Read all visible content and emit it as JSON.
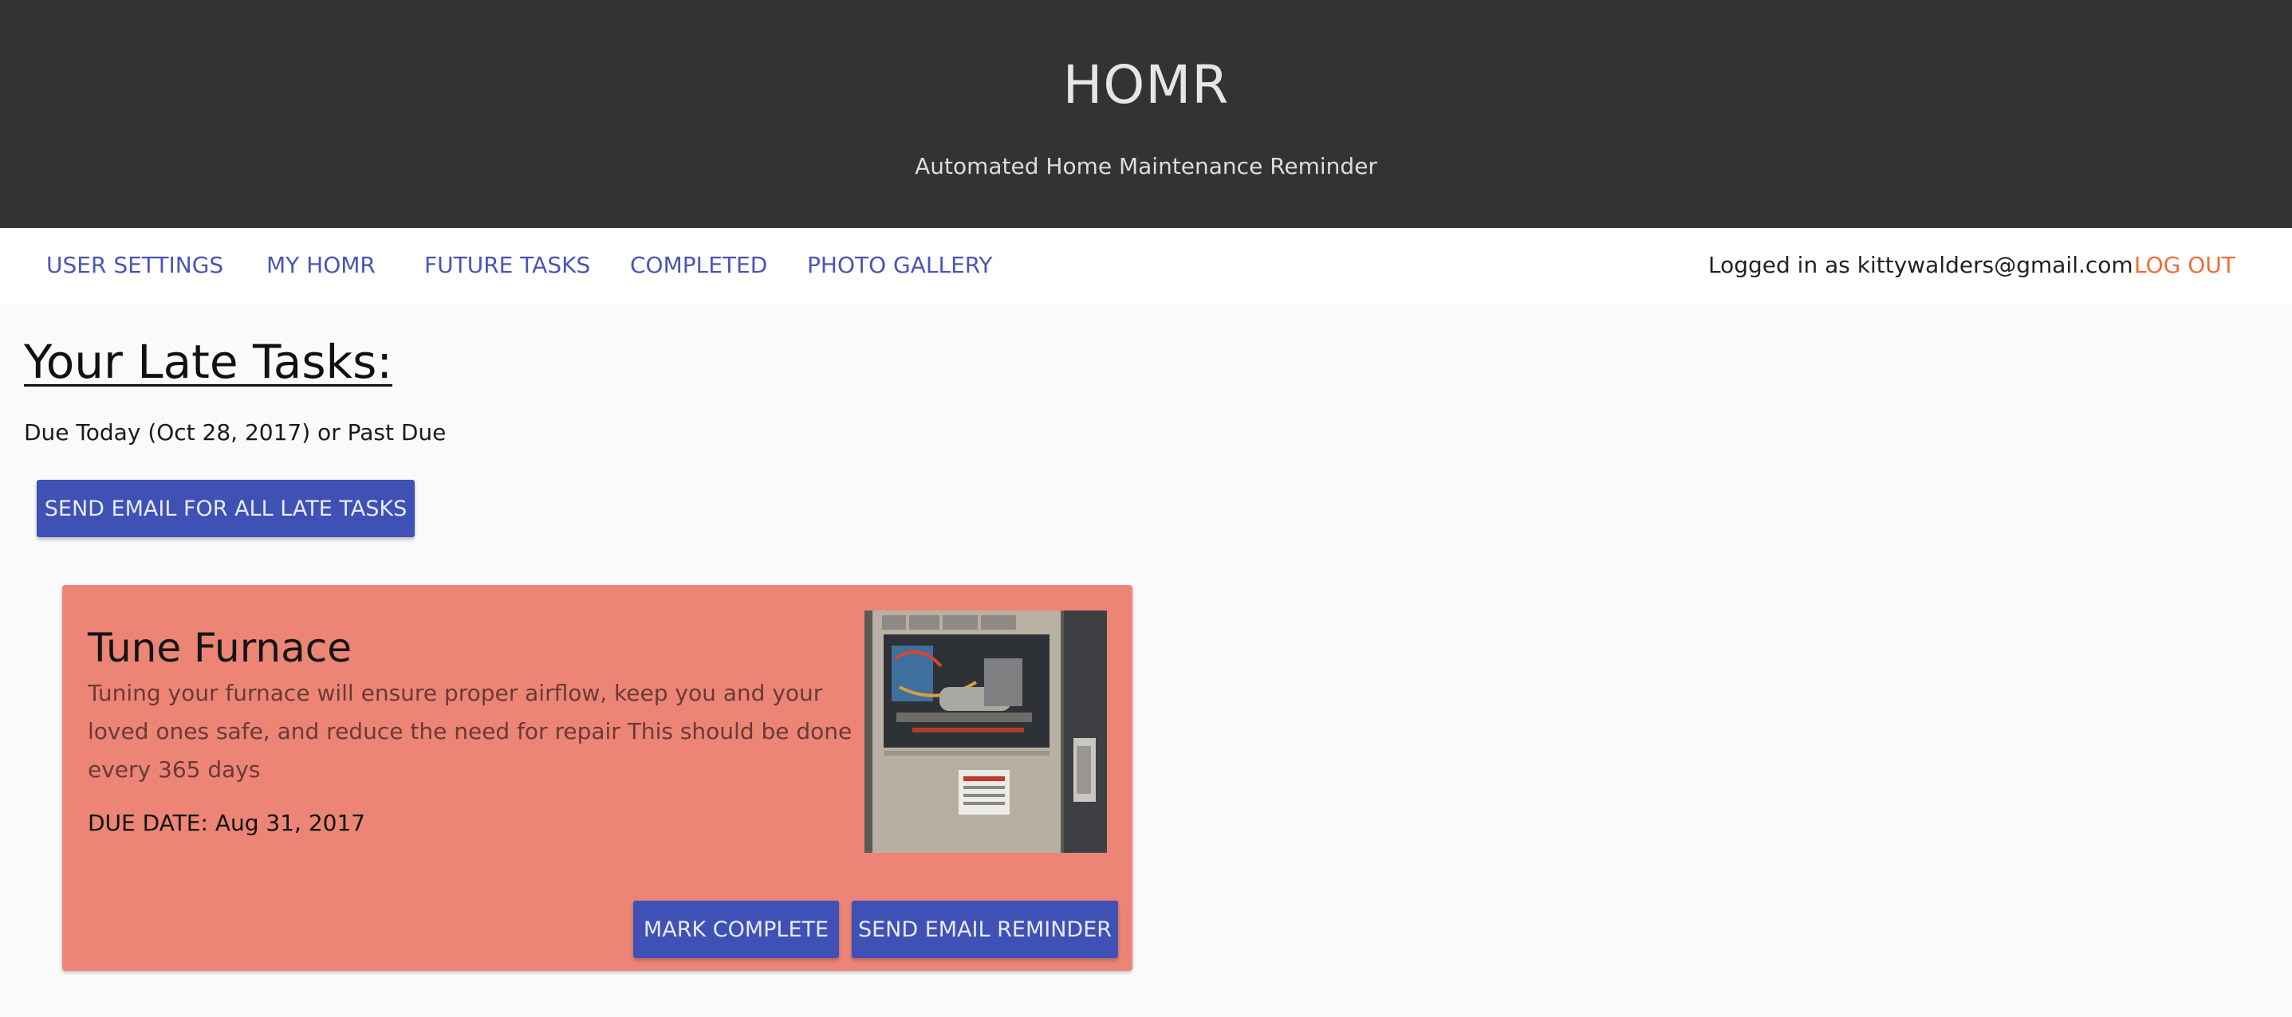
{
  "header": {
    "title": "HOMR",
    "subtitle": "Automated Home Maintenance Reminder"
  },
  "nav": {
    "items": [
      "USER SETTINGS",
      "MY HOMR",
      "FUTURE TASKS",
      "COMPLETED",
      "PHOTO GALLERY"
    ],
    "login_text": "Logged in as kittywalders@gmail.com",
    "logout_label": "LOG OUT"
  },
  "main": {
    "heading": "Your Late Tasks:",
    "due_line": "Due Today (Oct 28, 2017) or Past Due",
    "send_all_label": "SEND EMAIL FOR ALL LATE TASKS"
  },
  "task": {
    "title": "Tune Furnace",
    "description": "Tuning your furnace will ensure proper airflow, keep you and your loved ones safe, and reduce the need for repair This should be done every 365 days",
    "due_date": "DUE DATE: Aug 31, 2017",
    "mark_complete_label": "MARK COMPLETE",
    "send_reminder_label": "SEND EMAIL REMINDER",
    "photo_icon": "furnace-photo"
  },
  "colors": {
    "header_bg": "#333333",
    "nav_link": "#4a55b5",
    "logout": "#ee6e3a",
    "button": "#3f51b5",
    "card": "#ec8576"
  }
}
